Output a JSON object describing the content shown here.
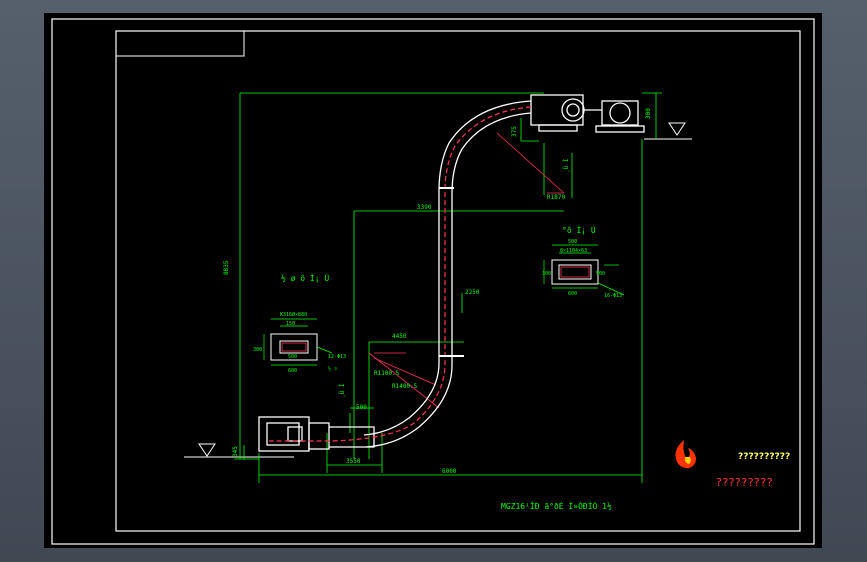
{
  "drawing": {
    "title": "MGZ16¹ÎÐ ã°ðÉ Ì»ÓÐÍÒ 1½",
    "colors": {
      "background": "#000000",
      "frame": "#ffffff",
      "dimension": "#00ff00",
      "chain": "#ff3355",
      "body": "#ffffff",
      "leader": "#ff3355"
    },
    "dimensions": {
      "total_height": "8835",
      "top_width": "3390",
      "middle_width": "4450",
      "right_bottom": "6000",
      "bottom_mid": "3550",
      "right_vertical": "2250",
      "left_small": "2400",
      "lower_small": "500",
      "top_right_side": "300",
      "top_left_v": "375",
      "bottom_left_v": "345",
      "radius_top": "R1870",
      "radius_inner": "R1100.5",
      "radius_outer": "R1400.5"
    },
    "section_left": {
      "caption": "½ ø ô Ì¡ Ú",
      "dim_top": "K316Ø×880",
      "dim_inner": "150",
      "dim_mid": "500",
      "dim_bottom": "600",
      "dim_side": "300",
      "hole_note": "12-Φ13",
      "side_note": "½ ¤",
      "vertical_label": "¸Ü Ì"
    },
    "section_right": {
      "caption": "°ô Ì¡ Ú",
      "dim_top": "500",
      "dim_inner": "8×1104×63",
      "dim_mid": "500",
      "dim_bottom": "600",
      "dim_side": "300",
      "hole_note": "16-Φ13",
      "vertical_label": "¸Ü Ì"
    },
    "logo": {
      "name": "??????????",
      "sub": "?????????"
    }
  }
}
